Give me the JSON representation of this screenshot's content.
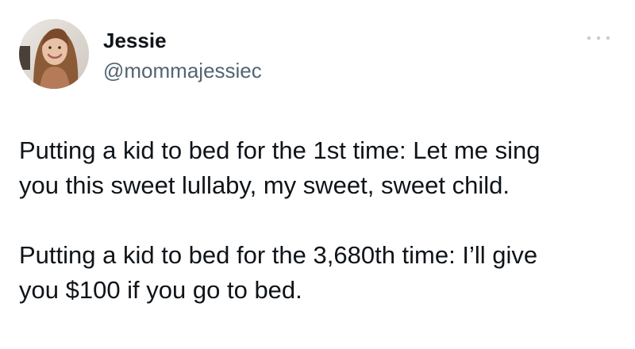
{
  "tweet": {
    "author": {
      "name": "Jessie",
      "handle": "@mommajessiec"
    },
    "more_icon": "more-horizontal-icon",
    "paragraphs": [
      {
        "lines": [
          "Putting a kid to bed for the 1st time: Let me sing",
          "you this sweet lullaby, my sweet, sweet child."
        ]
      },
      {
        "lines": [
          "Putting a kid to bed for the 3,680th time: I’ll give",
          "you $100 if you go to bed."
        ]
      }
    ]
  }
}
